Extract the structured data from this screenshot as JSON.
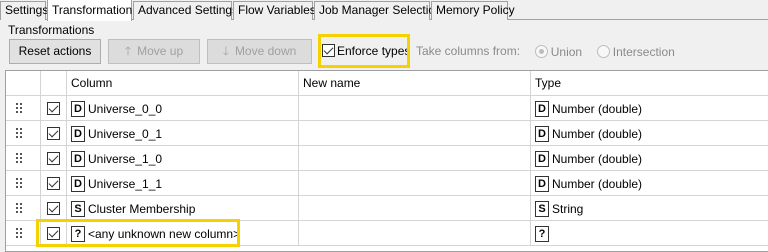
{
  "tabs": [
    {
      "label": "Settings",
      "active": false
    },
    {
      "label": "Transformation",
      "active": true
    },
    {
      "label": "Advanced Settings",
      "active": false
    },
    {
      "label": "Flow Variables",
      "active": false
    },
    {
      "label": "Job Manager Selection",
      "active": false
    },
    {
      "label": "Memory Policy",
      "active": false
    }
  ],
  "group_label": "Transformations",
  "toolbar": {
    "reset_label": "Reset actions",
    "move_up_label": "Move up",
    "move_down_label": "Move down",
    "enforce_types_label": "Enforce types",
    "enforce_types_checked": true,
    "take_columns_label": "Take columns from:",
    "union_label": "Union",
    "intersection_label": "Intersection",
    "take_columns_selected": "Union"
  },
  "table": {
    "headers": {
      "column": "Column",
      "new_name": "New name",
      "type": "Type"
    },
    "rows": [
      {
        "checked": true,
        "col_icon": "D",
        "column": "Universe_0_0",
        "new_name": "",
        "type_icon": "D",
        "type": "Number (double)"
      },
      {
        "checked": true,
        "col_icon": "D",
        "column": "Universe_0_1",
        "new_name": "",
        "type_icon": "D",
        "type": "Number (double)"
      },
      {
        "checked": true,
        "col_icon": "D",
        "column": "Universe_1_0",
        "new_name": "",
        "type_icon": "D",
        "type": "Number (double)"
      },
      {
        "checked": true,
        "col_icon": "D",
        "column": "Universe_1_1",
        "new_name": "",
        "type_icon": "D",
        "type": "Number (double)"
      },
      {
        "checked": true,
        "col_icon": "S",
        "column": "Cluster Membership",
        "new_name": "",
        "type_icon": "S",
        "type": "String"
      },
      {
        "checked": true,
        "col_icon": "?",
        "column": "<any unknown new column>",
        "new_name": "",
        "type_icon": "?",
        "type": ""
      }
    ]
  },
  "colors": {
    "highlight": "#f5d100"
  }
}
